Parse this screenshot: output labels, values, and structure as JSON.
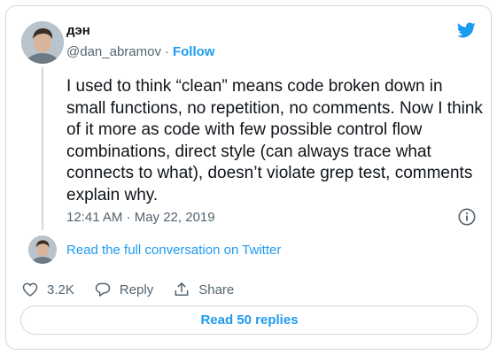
{
  "author": {
    "display_name": "дэн",
    "handle": "@dan_abramov",
    "separator": "·",
    "follow_label": "Follow"
  },
  "tweet": {
    "text": "I used to think “clean” means code broken down in small functions, no repetition, no comments. Now I think of it more as code with few possible control flow combinations, direct style (can always trace what connects to what), doesn’t violate grep test, comments explain why.",
    "timestamp": "12:41 AM · May 22, 2019"
  },
  "conversation": {
    "read_full_label": "Read the full conversation on Twitter"
  },
  "actions": {
    "likes_count": "3.2K",
    "reply_label": "Reply",
    "share_label": "Share"
  },
  "replies": {
    "read_replies_label": "Read 50 replies"
  },
  "icons": {
    "brand": "twitter-bird-icon",
    "info": "info-icon",
    "like": "heart-icon",
    "reply": "reply-bubble-icon",
    "share": "share-upload-icon"
  },
  "colors": {
    "accent": "#1d9bf0",
    "text_primary": "#0f1419",
    "text_secondary": "#536471",
    "border": "#cfd9de"
  }
}
